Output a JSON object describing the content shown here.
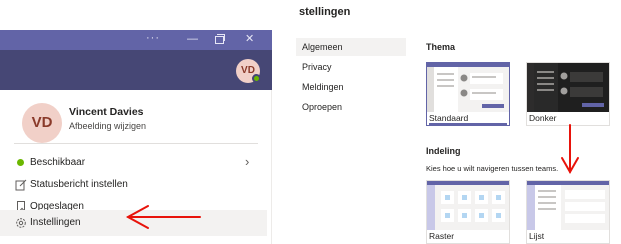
{
  "window": {
    "more_label": "···",
    "minimize_label": "—",
    "close_label": "✕",
    "app_avatar_initials": "VD",
    "accent_color": "#6264a7",
    "appbar_color": "#464775"
  },
  "profile": {
    "initials": "VD",
    "name": "Vincent Davies",
    "change_picture": "Afbeelding wijzigen"
  },
  "menu": {
    "items": [
      {
        "label": "Beschikbaar",
        "icon": "available-dot-icon"
      },
      {
        "label": "Statusbericht instellen",
        "icon": "edit-message-icon"
      },
      {
        "label": "Opgeslagen",
        "icon": "bookmark-icon"
      },
      {
        "label": "Instellingen",
        "icon": "gear-icon"
      }
    ]
  },
  "settings": {
    "title": "stellingen",
    "nav": [
      {
        "label": "Algemeen"
      },
      {
        "label": "Privacy"
      },
      {
        "label": "Meldingen"
      },
      {
        "label": "Oproepen"
      }
    ],
    "theme": {
      "heading": "Thema",
      "options": [
        {
          "label": "Standaard"
        },
        {
          "label": "Donker"
        }
      ]
    },
    "layout": {
      "heading": "Indeling",
      "description": "Kies hoe u wilt navigeren tussen teams.",
      "options": [
        {
          "label": "Raster"
        },
        {
          "label": "Lijst"
        }
      ]
    }
  },
  "annotations": {
    "arrow_color": "#e8130b"
  }
}
